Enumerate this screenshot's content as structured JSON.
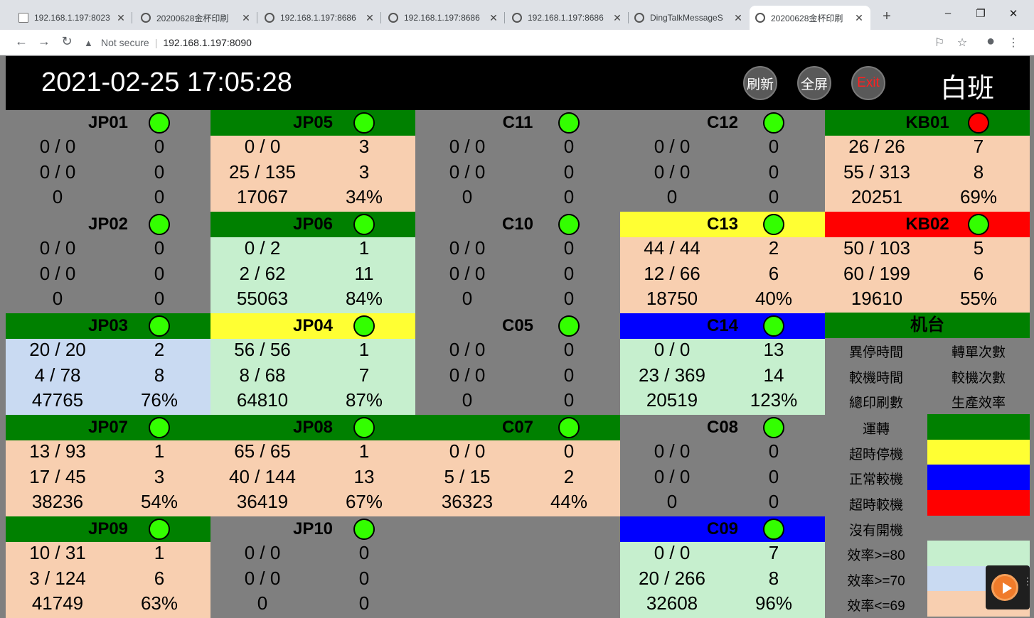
{
  "browser": {
    "tabs": [
      {
        "title": "192.168.1.197:8023",
        "icon": "document-icon",
        "active": false
      },
      {
        "title": "20200628金杯印刷",
        "icon": "globe-icon",
        "active": false
      },
      {
        "title": "192.168.1.197:8686",
        "icon": "globe-icon",
        "active": false
      },
      {
        "title": "192.168.1.197:8686",
        "icon": "globe-icon",
        "active": false
      },
      {
        "title": "192.168.1.197:8686",
        "icon": "globe-icon",
        "active": false
      },
      {
        "title": "DingTalkMessageS",
        "icon": "globe-icon",
        "active": false
      },
      {
        "title": "20200628金杯印刷",
        "icon": "globe-icon",
        "active": true
      }
    ],
    "close_glyph": "✕",
    "new_tab": "+",
    "window": {
      "minimize": "–",
      "restore": "❐",
      "close": "✕"
    },
    "nav": {
      "back": "←",
      "forward": "→",
      "reload": "↻"
    },
    "security_label": "Not secure",
    "address": "192.168.1.197:8090",
    "toolbar_icons": {
      "translate": "⚐",
      "bookmark": "☆",
      "profile": "●",
      "menu": "⋮"
    }
  },
  "header": {
    "datetime": "2021-02-25 17:05:28",
    "refresh_label": "刷新",
    "fullscreen_label": "全屏",
    "exit_label": "Exit",
    "shift": "白班"
  },
  "colors": {
    "running": "#008000",
    "overtime_stop": "#ffff33",
    "normal_calibration": "#0000ff",
    "overtime_calibration": "#ff0000",
    "not_started": "#7f7f7f",
    "eff_high": "#c6efce",
    "eff_mid": "#c9daf2",
    "eff_low": "#f8cfb0",
    "status_green": "#33ff00",
    "status_red": "#ff0000"
  },
  "machines": [
    {
      "name": "JP01",
      "col": 0,
      "row": 0,
      "title_color": "#7f7f7f",
      "body_color": "#7f7f7f",
      "status": "#33ff00",
      "values": [
        "0 / 0",
        "0",
        "0 / 0",
        "0",
        "0",
        "0"
      ]
    },
    {
      "name": "JP05",
      "col": 1,
      "row": 0,
      "title_color": "#008000",
      "body_color": "#f8cfb0",
      "status": "#33ff00",
      "values": [
        "0 / 0",
        "3",
        "25 / 135",
        "3",
        "17067",
        "34%"
      ]
    },
    {
      "name": "C11",
      "col": 2,
      "row": 0,
      "title_color": "#7f7f7f",
      "body_color": "#7f7f7f",
      "status": "#33ff00",
      "values": [
        "0 / 0",
        "0",
        "0 / 0",
        "0",
        "0",
        "0"
      ]
    },
    {
      "name": "C12",
      "col": 3,
      "row": 0,
      "title_color": "#7f7f7f",
      "body_color": "#7f7f7f",
      "status": "#33ff00",
      "values": [
        "0 / 0",
        "0",
        "0 / 0",
        "0",
        "0",
        "0"
      ]
    },
    {
      "name": "KB01",
      "col": 4,
      "row": 0,
      "title_color": "#008000",
      "body_color": "#f8cfb0",
      "status": "#ff0000",
      "values": [
        "26 / 26",
        "7",
        "55 / 313",
        "8",
        "20251",
        "69%"
      ]
    },
    {
      "name": "JP02",
      "col": 0,
      "row": 1,
      "title_color": "#7f7f7f",
      "body_color": "#7f7f7f",
      "status": "#33ff00",
      "values": [
        "0 / 0",
        "0",
        "0 / 0",
        "0",
        "0",
        "0"
      ]
    },
    {
      "name": "JP06",
      "col": 1,
      "row": 1,
      "title_color": "#008000",
      "body_color": "#c6efce",
      "status": "#33ff00",
      "values": [
        "0 / 2",
        "1",
        "2 / 62",
        "11",
        "55063",
        "84%"
      ]
    },
    {
      "name": "C10",
      "col": 2,
      "row": 1,
      "title_color": "#7f7f7f",
      "body_color": "#7f7f7f",
      "status": "#33ff00",
      "values": [
        "0 / 0",
        "0",
        "0 / 0",
        "0",
        "0",
        "0"
      ]
    },
    {
      "name": "C13",
      "col": 3,
      "row": 1,
      "title_color": "#ffff33",
      "body_color": "#f8cfb0",
      "status": "#33ff00",
      "values": [
        "44 / 44",
        "2",
        "12 / 66",
        "6",
        "18750",
        "40%"
      ]
    },
    {
      "name": "KB02",
      "col": 4,
      "row": 1,
      "title_color": "#ff0000",
      "body_color": "#f8cfb0",
      "status": "#33ff00",
      "values": [
        "50 / 103",
        "5",
        "60 / 199",
        "6",
        "19610",
        "55%"
      ]
    },
    {
      "name": "JP03",
      "col": 0,
      "row": 2,
      "title_color": "#008000",
      "body_color": "#c9daf2",
      "status": "#33ff00",
      "values": [
        "20 / 20",
        "2",
        "4 / 78",
        "8",
        "47765",
        "76%"
      ]
    },
    {
      "name": "JP04",
      "col": 1,
      "row": 2,
      "title_color": "#ffff33",
      "body_color": "#c6efce",
      "status": "#33ff00",
      "values": [
        "56 / 56",
        "1",
        "8 / 68",
        "7",
        "64810",
        "87%"
      ]
    },
    {
      "name": "C05",
      "col": 2,
      "row": 2,
      "title_color": "#7f7f7f",
      "body_color": "#7f7f7f",
      "status": "#33ff00",
      "values": [
        "0 / 0",
        "0",
        "0 / 0",
        "0",
        "0",
        "0"
      ]
    },
    {
      "name": "C14",
      "col": 3,
      "row": 2,
      "title_color": "#0000ff",
      "body_color": "#c6efce",
      "status": "#33ff00",
      "values": [
        "0 / 0",
        "13",
        "23 / 369",
        "14",
        "20519",
        "123%"
      ]
    },
    {
      "name": "JP07",
      "col": 0,
      "row": 3,
      "title_color": "#008000",
      "body_color": "#f8cfb0",
      "status": "#33ff00",
      "values": [
        "13 / 93",
        "1",
        "17 / 45",
        "3",
        "38236",
        "54%"
      ]
    },
    {
      "name": "JP08",
      "col": 1,
      "row": 3,
      "title_color": "#008000",
      "body_color": "#f8cfb0",
      "status": "#33ff00",
      "values": [
        "65 / 65",
        "1",
        "40 / 144",
        "13",
        "36419",
        "67%"
      ]
    },
    {
      "name": "C07",
      "col": 2,
      "row": 3,
      "title_color": "#008000",
      "body_color": "#f8cfb0",
      "status": "#33ff00",
      "values": [
        "0 / 0",
        "0",
        "5 / 15",
        "2",
        "36323",
        "44%"
      ]
    },
    {
      "name": "C08",
      "col": 3,
      "row": 3,
      "title_color": "#7f7f7f",
      "body_color": "#7f7f7f",
      "status": "#33ff00",
      "values": [
        "0 / 0",
        "0",
        "0 / 0",
        "0",
        "0",
        "0"
      ]
    },
    {
      "name": "JP09",
      "col": 0,
      "row": 4,
      "title_color": "#008000",
      "body_color": "#f8cfb0",
      "status": "#33ff00",
      "values": [
        "10 / 31",
        "1",
        "3 / 124",
        "6",
        "41749",
        "63%"
      ]
    },
    {
      "name": "JP10",
      "col": 1,
      "row": 4,
      "title_color": "#7f7f7f",
      "body_color": "#7f7f7f",
      "status": "#33ff00",
      "values": [
        "0 / 0",
        "0",
        "0 / 0",
        "0",
        "0",
        "0"
      ]
    },
    {
      "name": "C09",
      "col": 3,
      "row": 4,
      "title_color": "#0000ff",
      "body_color": "#c6efce",
      "status": "#33ff00",
      "values": [
        "0 / 0",
        "7",
        "20 / 266",
        "8",
        "32608",
        "96%"
      ]
    }
  ],
  "legend": {
    "title": "机台",
    "fields": [
      "異停時間",
      "轉單次數",
      "較機時間",
      "較機次數",
      "總印刷數",
      "生產效率"
    ],
    "states": [
      {
        "label": "運轉",
        "color": "#008000"
      },
      {
        "label": "超時停機",
        "color": "#ffff33"
      },
      {
        "label": "正常較機",
        "color": "#0000ff"
      },
      {
        "label": "超時較機",
        "color": "#ff0000"
      },
      {
        "label": "沒有開機",
        "color": "#7f7f7f"
      },
      {
        "label": "效率>=80",
        "color": "#c6efce"
      },
      {
        "label": "效率>=70",
        "color": "#c9daf2"
      },
      {
        "label": "效率<=69",
        "color": "#f8cfb0"
      }
    ]
  },
  "widget": {
    "icon": "record-play-icon",
    "menu_glyph": "⋮"
  }
}
